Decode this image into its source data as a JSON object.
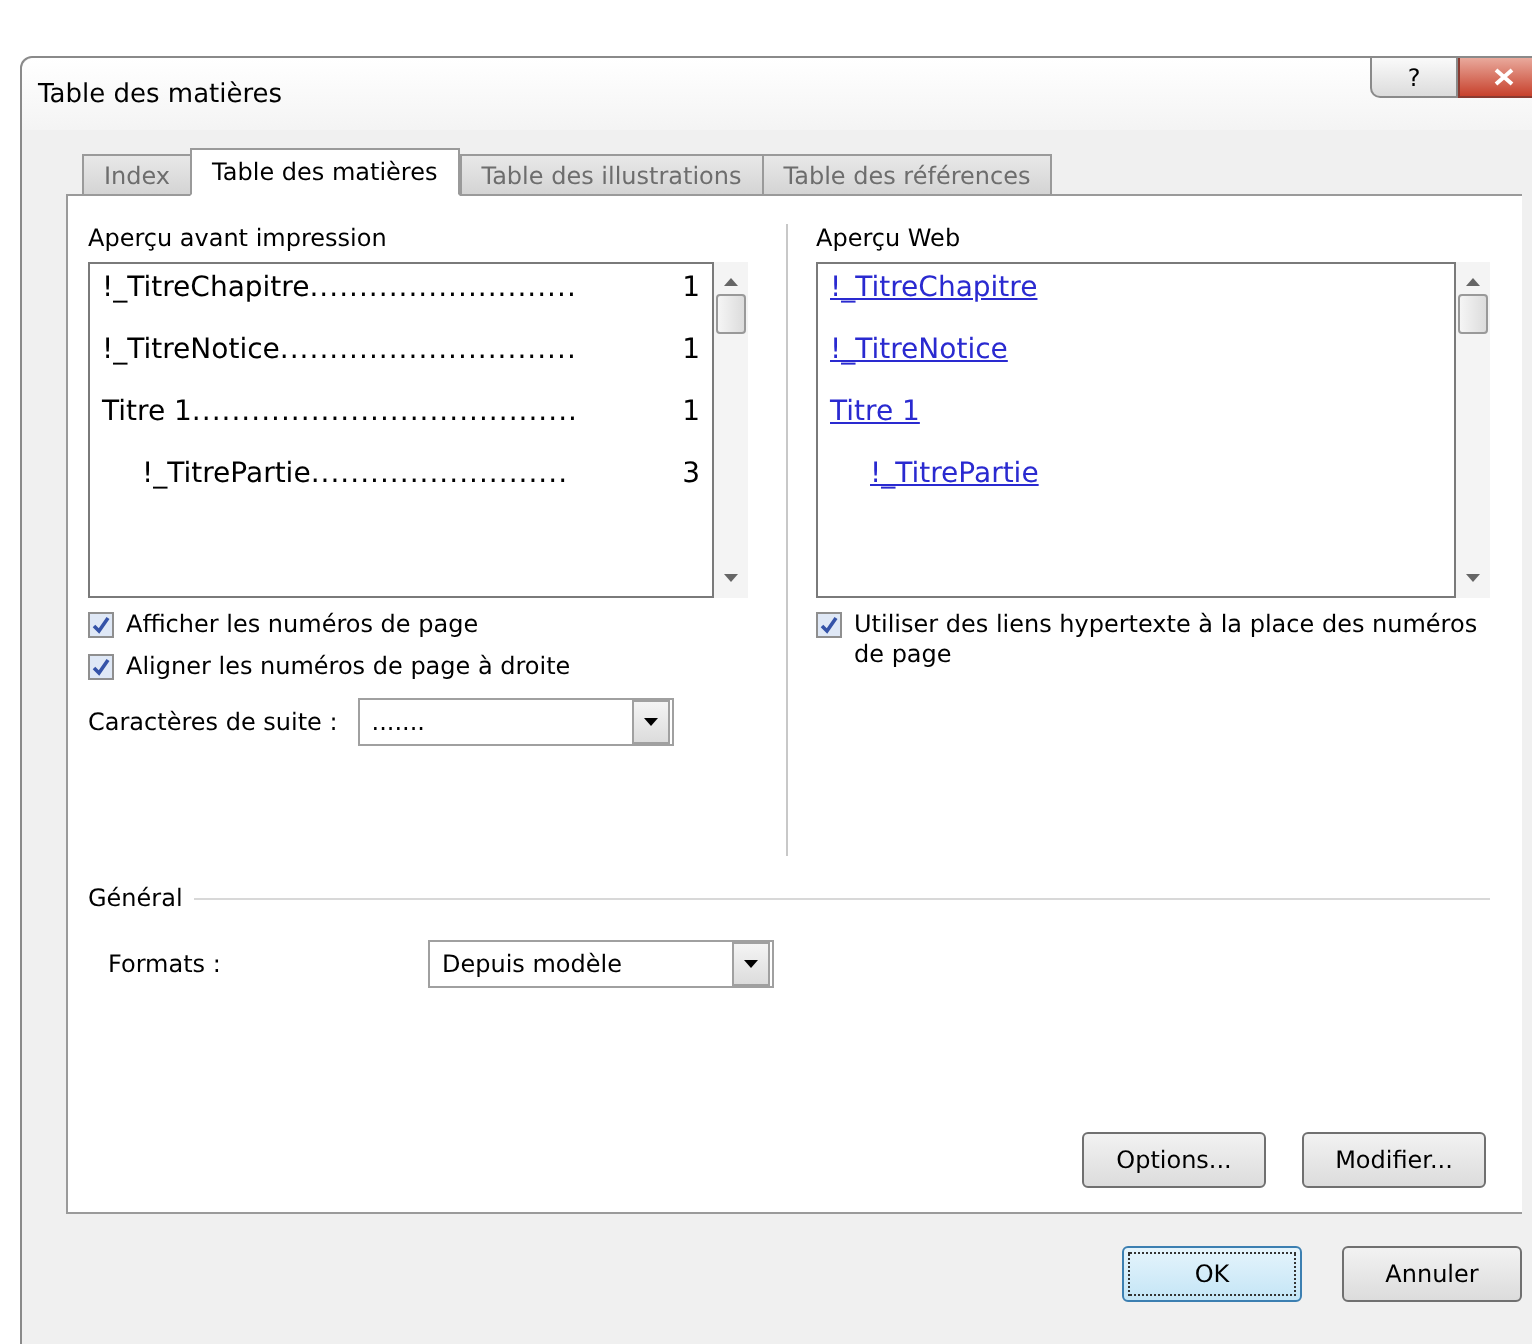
{
  "window": {
    "title": "Table des matières",
    "help_button": "?"
  },
  "tabs": [
    {
      "label": "Index",
      "selected": false
    },
    {
      "label": "Table des matières",
      "selected": true
    },
    {
      "label": "Table des illustrations",
      "selected": false
    },
    {
      "label": "Table des références",
      "selected": false
    }
  ],
  "print_preview": {
    "label": "Aperçu avant impression",
    "entries": [
      {
        "title": "!_TitreChapitre",
        "leader": "...........................",
        "page": "1"
      },
      {
        "title": "!_TitreNotice",
        "leader": "..............................",
        "page": "1"
      },
      {
        "title": "Titre 1",
        "leader": ".......................................",
        "page": "1",
        "children": [
          {
            "title": "!_TitrePartie",
            "leader": "..........................",
            "page": "3"
          }
        ]
      }
    ]
  },
  "web_preview": {
    "label": "Aperçu Web",
    "entries": [
      {
        "title": "!_TitreChapitre"
      },
      {
        "title": "!_TitreNotice"
      },
      {
        "title": "Titre 1",
        "children": [
          {
            "title": "!_TitrePartie"
          }
        ]
      }
    ]
  },
  "options_left": [
    {
      "label": "Afficher les numéros de page",
      "checked": true
    },
    {
      "label": "Aligner les numéros de page à droite",
      "checked": true
    }
  ],
  "tab_leader": {
    "label": "Caractères de suite :",
    "value": "......."
  },
  "options_right": [
    {
      "label": "Utiliser des liens hypertexte à la place des numéros de page",
      "checked": true
    }
  ],
  "general": {
    "label": "Général",
    "formats_label": "Formats :",
    "formats_value": "Depuis modèle"
  },
  "panel_buttons": [
    "Options...",
    "Modifier..."
  ],
  "dialog_buttons": [
    {
      "label": "OK",
      "default": true
    },
    {
      "label": "Annuler",
      "default": false
    }
  ]
}
